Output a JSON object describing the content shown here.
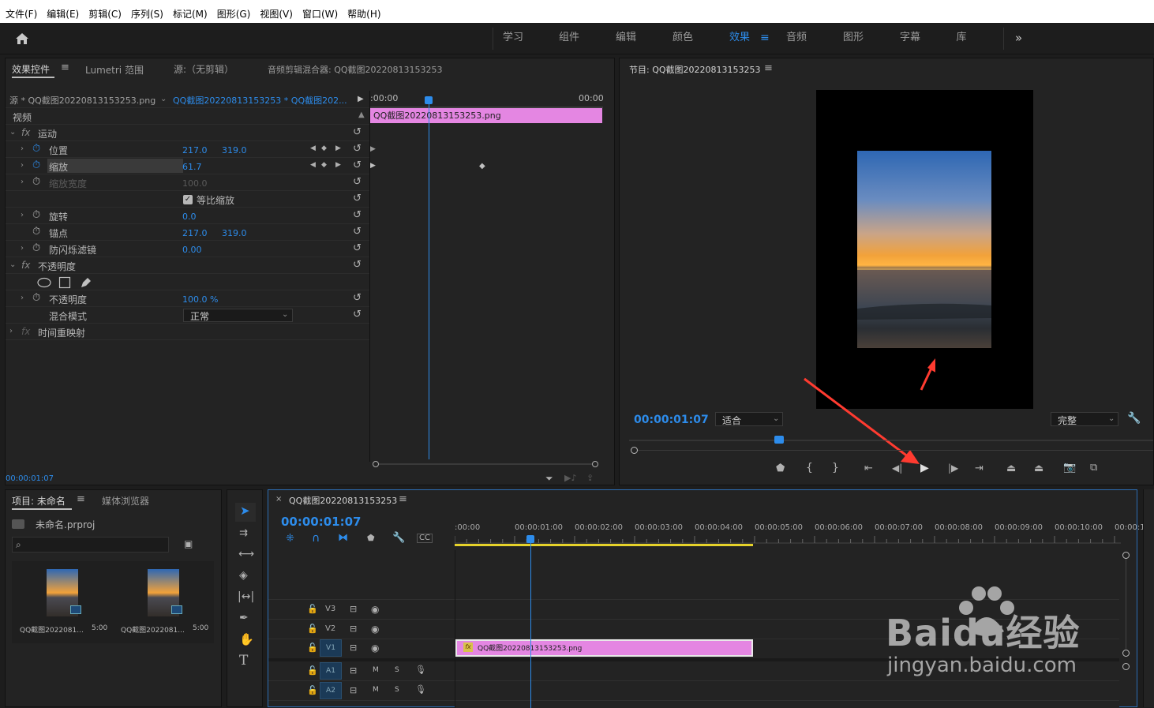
{
  "menu": [
    "文件(F)",
    "编辑(E)",
    "剪辑(C)",
    "序列(S)",
    "标记(M)",
    "图形(G)",
    "视图(V)",
    "窗口(W)",
    "帮助(H)"
  ],
  "workspaces": [
    "学习",
    "组件",
    "编辑",
    "颜色",
    "效果",
    "音频",
    "图形",
    "字幕",
    "库"
  ],
  "workspace_active": "效果",
  "workspace_more": "»",
  "effect_panel": {
    "tabs": [
      "效果控件",
      "Lumetri 范围",
      "源:（无剪辑）",
      "音频剪辑混合器: QQ截图20220813153253"
    ],
    "source_label": "源 * QQ截图20220813153253.png",
    "sequence_label": "QQ截图20220813153253 * QQ截图202...",
    "tc_start": ":00:00",
    "tc_end": "00:00",
    "clip_name": "QQ截图20220813153253.png",
    "video_header": "视频",
    "fx_motion": "运动",
    "position_label": "位置",
    "position_x": "217.0",
    "position_y": "319.0",
    "scale_label": "缩放",
    "scale_value": "61.7",
    "scale_width_label": "缩放宽度",
    "scale_width_value": "100.0",
    "uniform_scale_label": "等比缩放",
    "rotation_label": "旋转",
    "rotation_value": "0.0",
    "anchor_label": "锚点",
    "anchor_x": "217.0",
    "anchor_y": "319.0",
    "flicker_label": "防闪烁滤镜",
    "flicker_value": "0.00",
    "fx_opacity": "不透明度",
    "opacity_label": "不透明度",
    "opacity_value": "100.0 %",
    "blend_label": "混合模式",
    "blend_value": "正常",
    "time_remap": "时间重映射",
    "timecode": "00:00:01:07"
  },
  "program": {
    "title": "节目: QQ截图20220813153253",
    "timecode": "00:00:01:07",
    "fit": "适合",
    "quality": "完整"
  },
  "project": {
    "tabs": [
      "项目: 未命名",
      "媒体浏览器"
    ],
    "file": "未命名.prproj",
    "items": [
      {
        "name": "QQ截图2022081...",
        "dur": "5:00"
      },
      {
        "name": "QQ截图2022081...",
        "dur": "5:00"
      }
    ]
  },
  "timeline": {
    "title": "QQ截图20220813153253",
    "timecode": "00:00:01:07",
    "ruler": [
      ":00:00",
      "00:00:01:00",
      "00:00:02:00",
      "00:00:03:00",
      "00:00:04:00",
      "00:00:05:00",
      "00:00:06:00",
      "00:00:07:00",
      "00:00:08:00",
      "00:00:09:00",
      "00:00:10:00",
      "00:00:1"
    ],
    "tracks": [
      "V3",
      "V2",
      "V1",
      "A1",
      "A2"
    ],
    "clip_name": "QQ截图20220813153253.png",
    "mute": "M",
    "solo": "S"
  },
  "watermark": {
    "brand": "Baidu经验",
    "url": "jingyan.baidu.com"
  },
  "colors": {
    "accent": "#2d8ceb",
    "clip": "#e486e2",
    "arrow": "#ff3b30"
  }
}
